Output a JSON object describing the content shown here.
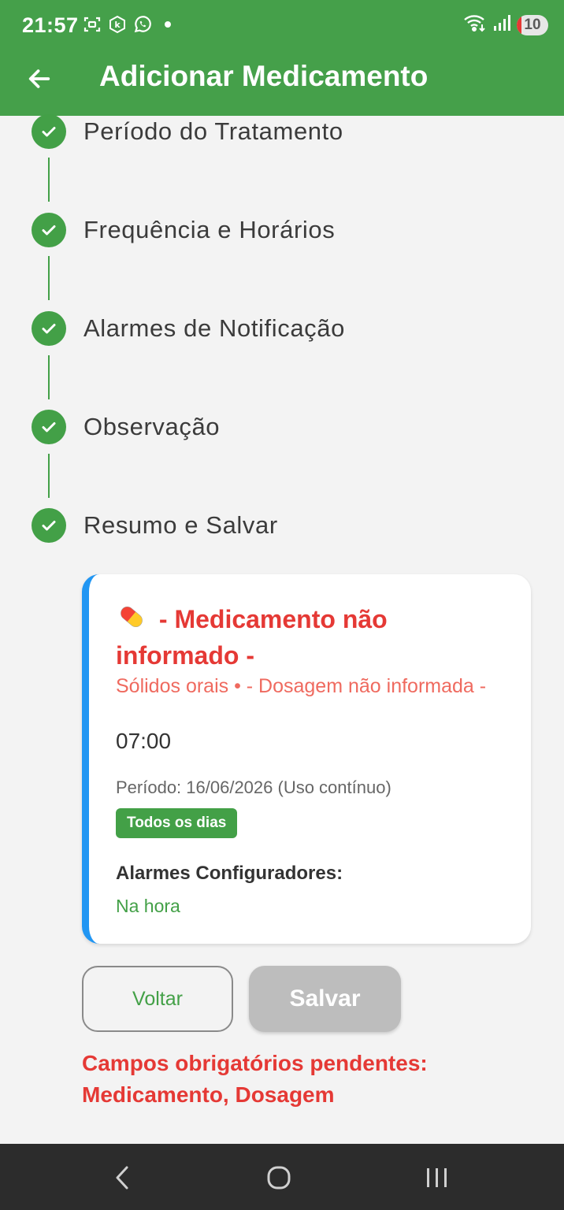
{
  "status_bar": {
    "time": "21:57",
    "battery": "10",
    "icons": [
      "screenshot-icon",
      "k-app-icon",
      "whatsapp-icon",
      "dot-icon",
      "wifi-icon",
      "signal-icon"
    ]
  },
  "app_bar": {
    "title": "Adicionar Medicamento",
    "back_icon": "arrow-left-icon"
  },
  "steps": [
    {
      "label": "Período do Tratamento",
      "done": true
    },
    {
      "label": "Frequência e Horários",
      "done": true
    },
    {
      "label": "Alarmes de Notificação",
      "done": true
    },
    {
      "label": "Observação",
      "done": true
    },
    {
      "label": "Resumo e Salvar",
      "done": true
    }
  ],
  "summary": {
    "emoji": "pill-emoji",
    "med_title": "- Medicamento não informado -",
    "subtitle": "Sólidos orais • - Dosagem não informada -",
    "time": "07:00",
    "period": "Período: 16/06/2026 (Uso contínuo)",
    "frequency_badge": "Todos os dias",
    "alarms_title": "Alarmes Configuradores:",
    "alarms": [
      "Na hora"
    ]
  },
  "buttons": {
    "back": "Voltar",
    "save": "Salvar"
  },
  "pending": {
    "line1": "Campos obrigatórios pendentes:",
    "line2": "Medicamento, Dosagem"
  },
  "colors": {
    "primary": "#45a04a",
    "error": "#e53935",
    "card_accent": "#2196f3",
    "disabled": "#bdbdbd"
  }
}
